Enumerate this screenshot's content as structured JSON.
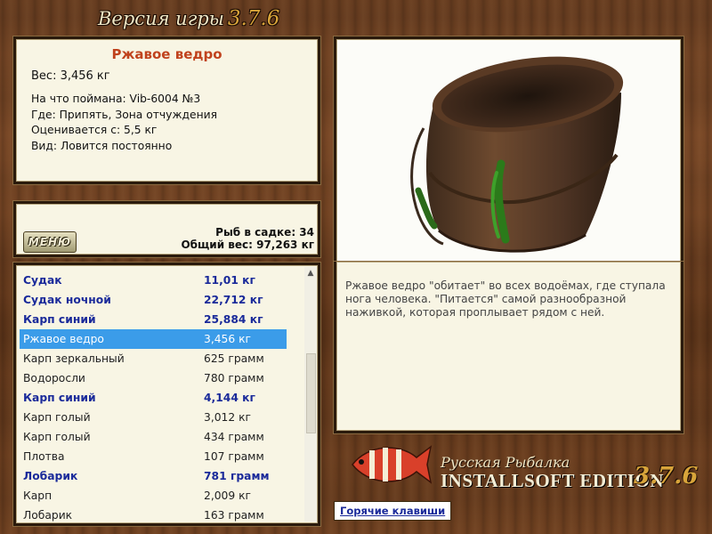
{
  "window": {
    "title": "Версия игры",
    "version": "3.7.6"
  },
  "catch": {
    "title": "Ржавое ведро",
    "weight": "Вес: 3,456 кг",
    "caught_on": "На что поймана: Vib-6004 №3",
    "location": "Где: Припять, Зона отчуждения",
    "value": "Оценивается с: 5,5 кг",
    "kind": "Вид: Ловится постоянно",
    "description": "Ржавое ведро \"обитает\" во всех водоёмах, где ступала нога человека. \"Питается\" самой разнообразной наживкой, которая проплывает рядом с ней."
  },
  "stats": {
    "menu_label": "МЕНЮ",
    "fish_count": "Рыб в садке: 34",
    "total_weight": "Общий вес: 97,263 кг"
  },
  "fish_list": [
    {
      "name": "Судак",
      "weight": "11,01 кг",
      "bold": true
    },
    {
      "name": "Судак ночной",
      "weight": "22,712 кг",
      "bold": true
    },
    {
      "name": "Карп синий",
      "weight": "25,884 кг",
      "bold": true
    },
    {
      "name": "Ржавое ведро",
      "weight": "3,456 кг",
      "selected": true
    },
    {
      "name": "Карп зеркальный",
      "weight": "625 грамм"
    },
    {
      "name": "Водоросли",
      "weight": "780 грамм"
    },
    {
      "name": "Карп синий",
      "weight": "4,144 кг",
      "bold": true
    },
    {
      "name": "Карп голый",
      "weight": "3,012 кг"
    },
    {
      "name": "Карп голый",
      "weight": "434 грамм"
    },
    {
      "name": "Плотва",
      "weight": "107 грамм"
    },
    {
      "name": "Лобарик",
      "weight": "781 грамм",
      "bold": true
    },
    {
      "name": "Карп",
      "weight": "2,009 кг"
    },
    {
      "name": "Лобарик",
      "weight": "163 грамм"
    }
  ],
  "hotkeys_label": "Горячие клавиши",
  "logo": {
    "line1": "Русская Рыбалка",
    "line2": "INSTALLSOFT EDITION",
    "version": "3.7.6"
  },
  "colors": {
    "highlight": "#3b9ce9",
    "bold_text": "#1a2a9a",
    "title_text": "#c0421d",
    "version_gold": "#d8a43a"
  },
  "icons": {
    "scroll": "chevron-up-icon",
    "image": "rusty-bucket-illustration",
    "logo": "fish-icon"
  }
}
